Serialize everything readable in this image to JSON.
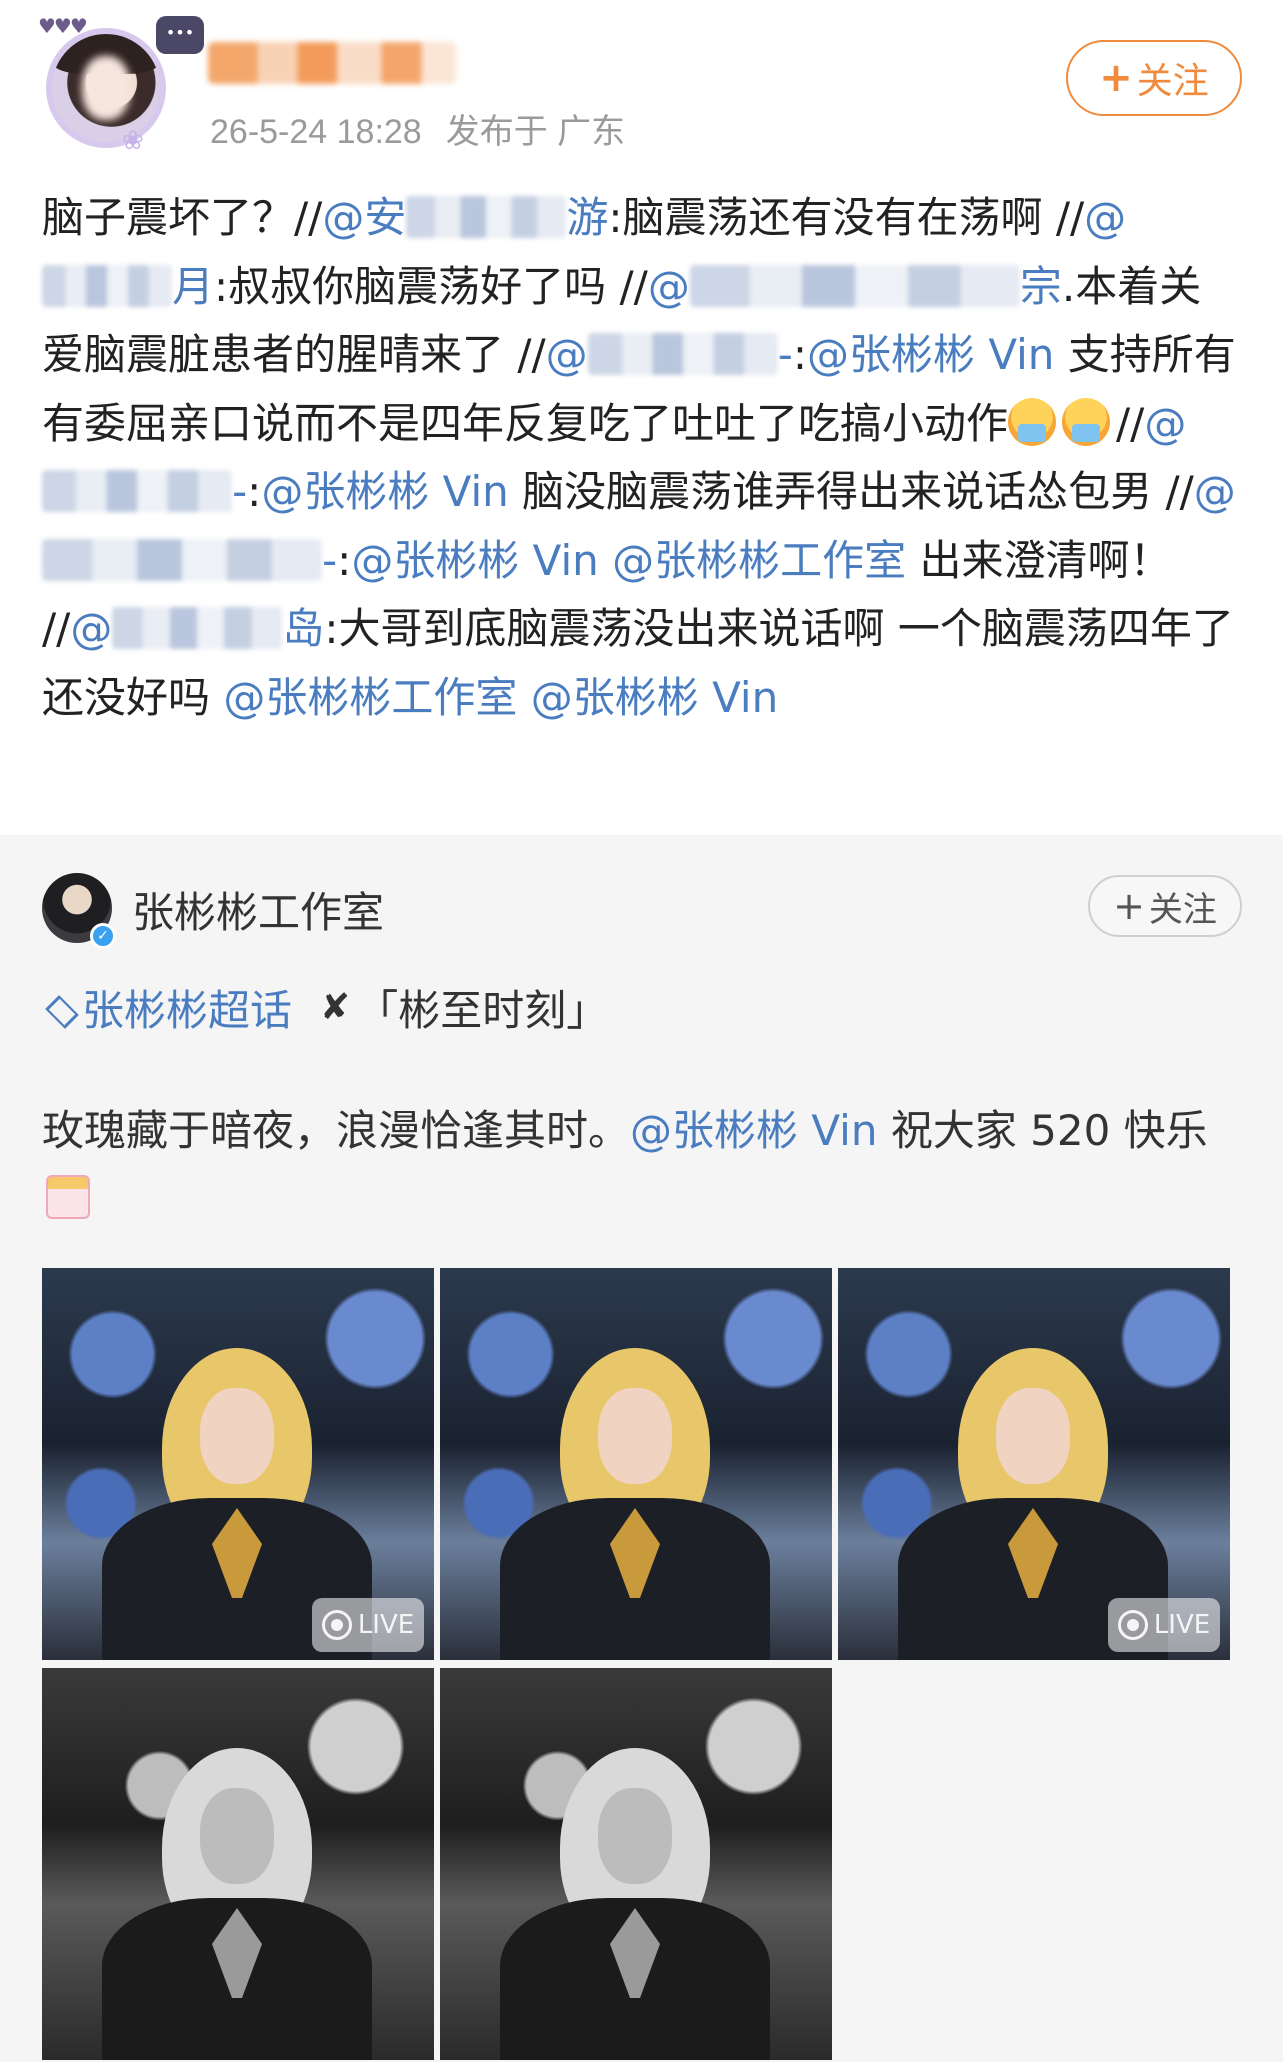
{
  "header": {
    "timestamp": "26-5-24 18:28",
    "location": "发布于 广东",
    "follow_label": "关注"
  },
  "repost": {
    "segments": [
      {
        "type": "text",
        "value": "脑子震坏了？//"
      },
      {
        "type": "mention",
        "value": "@安"
      },
      {
        "type": "blur",
        "w": 160
      },
      {
        "type": "mention",
        "value": "游"
      },
      {
        "type": "text",
        "value": ":脑震荡还有没有在荡啊 //"
      },
      {
        "type": "mention",
        "value": "@"
      },
      {
        "type": "blur",
        "w": 130
      },
      {
        "type": "mention",
        "value": "月"
      },
      {
        "type": "text",
        "value": ":叔叔你脑震荡好了吗 //"
      },
      {
        "type": "mention",
        "value": "@"
      },
      {
        "type": "blur",
        "w": 330
      },
      {
        "type": "mention",
        "value": "宗"
      },
      {
        "type": "text",
        "value": ".本着关爱脑震脏患者的腥晴来了 //"
      },
      {
        "type": "mention",
        "value": "@"
      },
      {
        "type": "blur",
        "w": 190
      },
      {
        "type": "mention",
        "value": "-"
      },
      {
        "type": "text",
        "value": ":"
      },
      {
        "type": "mention",
        "value": "@张彬彬 Vin"
      },
      {
        "type": "text",
        "value": " 支持所有有委屈亲口说而不是四年反复吃了吐吐了吃搞小动作"
      },
      {
        "type": "emoji"
      },
      {
        "type": "emoji"
      },
      {
        "type": "text",
        "value": "//"
      },
      {
        "type": "mention",
        "value": "@"
      },
      {
        "type": "blur",
        "w": 190
      },
      {
        "type": "mention",
        "value": "-"
      },
      {
        "type": "text",
        "value": ":"
      },
      {
        "type": "mention",
        "value": "@张彬彬 Vin"
      },
      {
        "type": "text",
        "value": " 脑没脑震荡谁弄得出来说话怂包男 //"
      },
      {
        "type": "mention",
        "value": "@"
      },
      {
        "type": "blur",
        "w": 280
      },
      {
        "type": "mention",
        "value": "-"
      },
      {
        "type": "text",
        "value": ":"
      },
      {
        "type": "mention",
        "value": "@张彬彬 Vin"
      },
      {
        "type": "text",
        "value": " "
      },
      {
        "type": "mention",
        "value": "@张彬彬工作室"
      },
      {
        "type": "text",
        "value": " 出来澄清啊！ //"
      },
      {
        "type": "mention",
        "value": "@"
      },
      {
        "type": "blur",
        "w": 170
      },
      {
        "type": "mention",
        "value": "岛"
      },
      {
        "type": "text",
        "value": ":大哥到底脑震荡没出来说话啊 一个脑震荡四年了还没好吗 "
      },
      {
        "type": "mention",
        "value": "@张彬彬工作室"
      },
      {
        "type": "text",
        "value": " "
      },
      {
        "type": "mention",
        "value": "@张彬彬 Vin"
      }
    ]
  },
  "original": {
    "author": "张彬彬工作室",
    "follow_label": "关注",
    "topic": "张彬彬超话",
    "tag": "「彬至时刻」",
    "text_before": "玫瑰藏于暗夜，浪漫恰逢其时。",
    "mention": "@张彬彬 Vin",
    "text_after": " 祝大家 520 快乐",
    "live_label": "LIVE",
    "photos": [
      {
        "tone": "color",
        "live": true
      },
      {
        "tone": "color",
        "live": false
      },
      {
        "tone": "color",
        "live": true
      },
      {
        "tone": "mono",
        "live": false
      },
      {
        "tone": "mono",
        "live": false
      }
    ]
  },
  "colors": {
    "link": "#4a7cc0",
    "follow_orange": "#f08a3c",
    "card_bg": "#f5f5f6"
  }
}
